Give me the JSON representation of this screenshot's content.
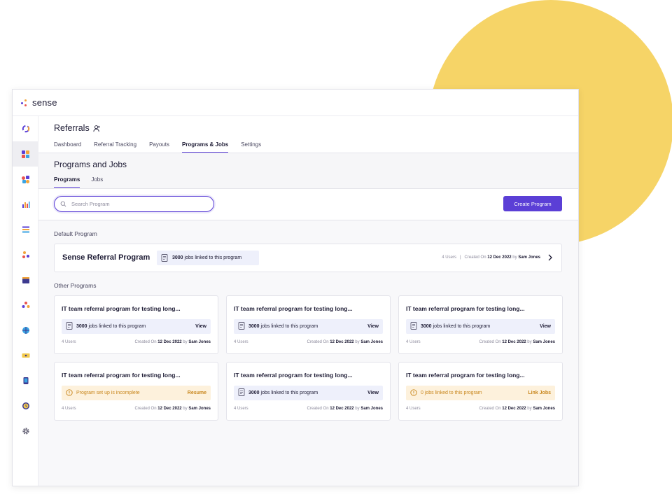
{
  "app": {
    "logo_text": "sense"
  },
  "header": {
    "title": "Referrals",
    "tabs": [
      "Dashboard",
      "Referral Tracking",
      "Payouts",
      "Programs & Jobs",
      "Settings"
    ]
  },
  "subheader": {
    "title": "Programs and Jobs",
    "tabs": [
      "Programs",
      "Jobs"
    ]
  },
  "search": {
    "placeholder": "Search Program",
    "value": ""
  },
  "create_button": "Create Program",
  "default_section": {
    "label": "Default Program",
    "program": {
      "title": "Sense Referral Program",
      "jobs_count": "3000",
      "jobs_text": "jobs linked to this program",
      "users": "4 Users",
      "separator": "|",
      "created_prefix": "Created On",
      "created_date": "12 Dec 2022",
      "created_by_prefix": "by",
      "created_by": "Sam Jones"
    }
  },
  "other_section": {
    "label": "Other Programs",
    "cards": [
      {
        "title": "IT team referral program for testing long...",
        "pill_bold": "3000",
        "pill_text": "jobs linked to this program",
        "action": "View",
        "users": "4 Users",
        "created_prefix": "Created On",
        "created_date": "12 Dec 2022",
        "created_by_prefix": "by",
        "created_by": "Sam Jones"
      },
      {
        "title": "IT team referral program for testing long...",
        "pill_bold": "3000",
        "pill_text": "jobs linked to this program",
        "action": "View",
        "users": "4 Users",
        "created_prefix": "Created On",
        "created_date": "12 Dec 2022",
        "created_by_prefix": "by",
        "created_by": "Sam Jones"
      },
      {
        "title": "IT team referral program for testing long...",
        "pill_bold": "3000",
        "pill_text": "jobs linked to this program",
        "action": "View",
        "users": "4 Users",
        "created_prefix": "Created On",
        "created_date": "12 Dec 2022",
        "created_by_prefix": "by",
        "created_by": "Sam Jones"
      },
      {
        "title": "IT team referral program for testing long...",
        "pill_bold": "",
        "pill_text": "Program set up is incomplete",
        "action": "Resume",
        "users": "4 Users",
        "created_prefix": "Created On",
        "created_date": "12 Dec 2022",
        "created_by_prefix": "by",
        "created_by": "Sam Jones"
      },
      {
        "title": "IT team referral program for testing long...",
        "pill_bold": "3000",
        "pill_text": "jobs linked to this program",
        "action": "View",
        "users": "4 Users",
        "created_prefix": "Created On",
        "created_date": "12 Dec 2022",
        "created_by_prefix": "by",
        "created_by": "Sam Jones"
      },
      {
        "title": "IT team referral program for testing long...",
        "pill_bold": "",
        "pill_text": "0 jobs linked to this program",
        "action": "Link Jobs",
        "users": "4 Users",
        "created_prefix": "Created On",
        "created_date": "12 Dec 2022",
        "created_by_prefix": "by",
        "created_by": "Sam Jones"
      }
    ]
  },
  "sidebar": {
    "items": [
      {
        "icon": "loading-ring-icon",
        "active": false
      },
      {
        "icon": "referrals-icon",
        "active": true
      },
      {
        "icon": "engage-icon",
        "active": false
      },
      {
        "icon": "analytics-icon",
        "active": false
      },
      {
        "icon": "list-icon",
        "active": false
      },
      {
        "icon": "people-icon",
        "active": false
      },
      {
        "icon": "calendar-icon",
        "active": false
      },
      {
        "icon": "team-icon",
        "active": false
      },
      {
        "icon": "globe-icon",
        "active": false
      },
      {
        "icon": "ticket-icon",
        "active": false
      },
      {
        "icon": "phone-icon",
        "active": false
      },
      {
        "icon": "clock-icon",
        "active": false
      },
      {
        "icon": "gear-icon",
        "active": false
      }
    ]
  },
  "colors": {
    "accent": "#5b3fd6",
    "blob": "#f6d467",
    "warning": "#c8861c",
    "info_bg": "#eef0fb",
    "warn_bg": "#fdf1dc"
  }
}
